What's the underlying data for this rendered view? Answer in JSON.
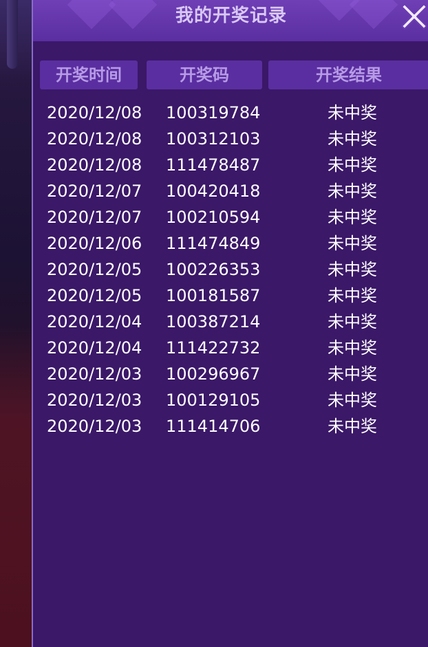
{
  "panel": {
    "title": "我的开奖记录"
  },
  "close": {
    "icon": "close-icon"
  },
  "table": {
    "headers": [
      "开奖时间",
      "开奖码",
      "开奖结果"
    ],
    "rows": [
      {
        "date": "2020/12/08",
        "code": "100319784",
        "result": "未中奖"
      },
      {
        "date": "2020/12/08",
        "code": "100312103",
        "result": "未中奖"
      },
      {
        "date": "2020/12/08",
        "code": "111478487",
        "result": "未中奖"
      },
      {
        "date": "2020/12/07",
        "code": "100420418",
        "result": "未中奖"
      },
      {
        "date": "2020/12/07",
        "code": "100210594",
        "result": "未中奖"
      },
      {
        "date": "2020/12/06",
        "code": "111474849",
        "result": "未中奖"
      },
      {
        "date": "2020/12/05",
        "code": "100226353",
        "result": "未中奖"
      },
      {
        "date": "2020/12/05",
        "code": "100181587",
        "result": "未中奖"
      },
      {
        "date": "2020/12/04",
        "code": "100387214",
        "result": "未中奖"
      },
      {
        "date": "2020/12/04",
        "code": "111422732",
        "result": "未中奖"
      },
      {
        "date": "2020/12/03",
        "code": "100296967",
        "result": "未中奖"
      },
      {
        "date": "2020/12/03",
        "code": "100129105",
        "result": "未中奖"
      },
      {
        "date": "2020/12/03",
        "code": "111414706",
        "result": "未中奖"
      }
    ]
  },
  "colors": {
    "panel_bg": "#3b1868",
    "header_bg": "#5a2ea0",
    "header_text": "#b79be6",
    "title_text": "#d9c8f5",
    "row_text": "#ffffff"
  }
}
